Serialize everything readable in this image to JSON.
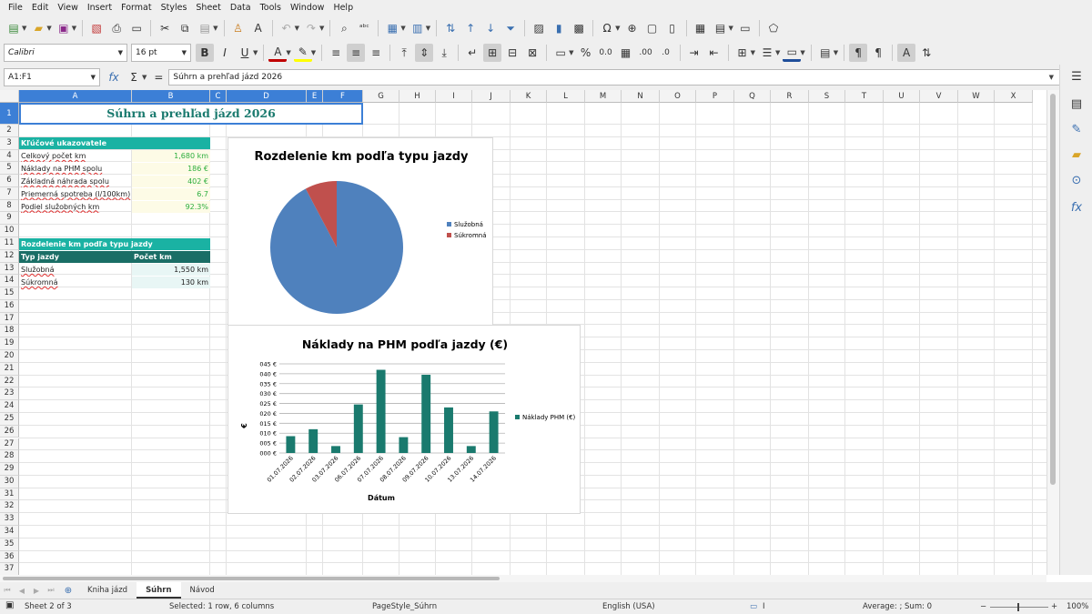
{
  "menu": [
    "File",
    "Edit",
    "View",
    "Insert",
    "Format",
    "Styles",
    "Sheet",
    "Data",
    "Tools",
    "Window",
    "Help"
  ],
  "toolbar": {
    "font_name": "Calibri",
    "font_size": "16 pt"
  },
  "formula": {
    "name_box": "A1:F1",
    "content": "Súhrn a prehľad jázd 2026"
  },
  "columns": [
    "A",
    "B",
    "C",
    "D",
    "E",
    "F",
    "G",
    "H",
    "I",
    "J",
    "K",
    "L",
    "M",
    "N",
    "O",
    "P",
    "Q",
    "R",
    "S",
    "T",
    "U",
    "V",
    "W",
    "X"
  ],
  "rows": [
    "1",
    "2",
    "3",
    "4",
    "5",
    "6",
    "7",
    "8",
    "9",
    "10",
    "11",
    "12",
    "13",
    "14",
    "15",
    "16",
    "17",
    "18",
    "19",
    "20",
    "21",
    "22",
    "23",
    "24",
    "25",
    "26",
    "27",
    "28",
    "29",
    "30",
    "31",
    "32",
    "33",
    "34",
    "35",
    "36",
    "37"
  ],
  "sheet": {
    "title": "Súhrn a prehľad jázd 2026",
    "kpi_header": "Kľúčové ukazovatele",
    "kpis": [
      {
        "label": "Celkový počet km",
        "value": "1,680 km"
      },
      {
        "label": "Náklady na PHM spolu",
        "value": "186 €"
      },
      {
        "label": "Základná náhrada spolu",
        "value": "402 €"
      },
      {
        "label": "Priemerná spotreba (l/100km)",
        "value": "6.7"
      },
      {
        "label": "Podiel služobných km",
        "value": "92.3%"
      }
    ],
    "breakdown_header": "Rozdelenie km podľa typu jazdy",
    "breakdown_cols": [
      "Typ jazdy",
      "Počet km"
    ],
    "breakdown_rows": [
      {
        "type": "Služobná",
        "km": "1,550 km"
      },
      {
        "type": "Súkromná",
        "km": "130 km"
      }
    ]
  },
  "chart_data": [
    {
      "type": "pie",
      "title": "Rozdelenie km podľa typu jazdy",
      "categories": [
        "Služobná",
        "Súkromná"
      ],
      "values": [
        1550,
        130
      ],
      "colors": [
        "#4f81bd",
        "#c0504d"
      ],
      "legend": "right"
    },
    {
      "type": "bar",
      "title": "Náklady na PHM podľa jazdy (€)",
      "xlabel": "Dátum",
      "ylabel": "€",
      "categories": [
        "01.07.2026",
        "02.07.2026",
        "03.07.2026",
        "06.07.2026",
        "07.07.2026",
        "08.07.2026",
        "09.07.2026",
        "10.07.2026",
        "13.07.2026",
        "14.07.2026"
      ],
      "series": [
        {
          "name": "Náklady PHM (€)",
          "values": [
            8.5,
            12,
            3.5,
            24.5,
            42,
            8,
            39.5,
            23,
            3.5,
            21
          ]
        }
      ],
      "yticks": [
        "000 €",
        "005 €",
        "010 €",
        "015 €",
        "020 €",
        "025 €",
        "030 €",
        "035 €",
        "040 €",
        "045 €"
      ],
      "ylim": [
        0,
        45
      ],
      "color": "#1a7a6e",
      "grid": true,
      "legend": "right"
    }
  ],
  "tabs": [
    "Kniha jázd",
    "Súhrn",
    "Návod"
  ],
  "status": {
    "sheet": "Sheet 2 of 3",
    "selection": "Selected: 1 row, 6 columns",
    "page_style": "PageStyle_Súhrn",
    "language": "English (USA)",
    "sum": "Average: ; Sum: 0",
    "zoom": "100%"
  }
}
